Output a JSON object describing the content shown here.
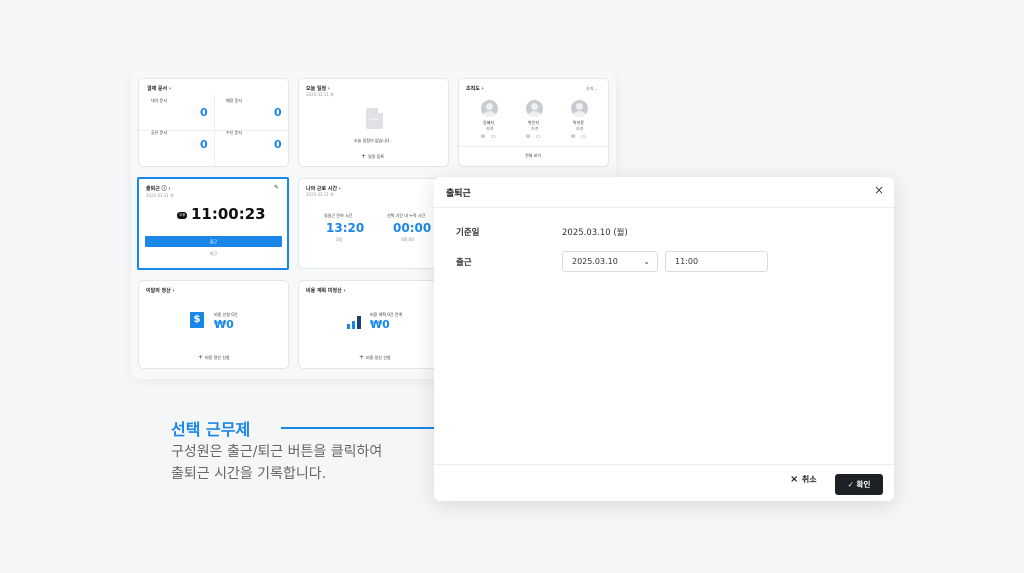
{
  "approval": {
    "title": "결재 문서",
    "items": [
      {
        "label": "대기 문서",
        "count": "0"
      },
      {
        "label": "예정 문서",
        "count": "0"
      },
      {
        "label": "공유 문서",
        "count": "0"
      },
      {
        "label": "수신 문서",
        "count": "0"
      }
    ]
  },
  "schedule": {
    "title": "오늘 일정",
    "date": "2025.03.11 화",
    "empty": "오늘 일정이 없습니다.",
    "add": "일정 등록"
  },
  "org": {
    "title": "조직도",
    "filter": "회계",
    "people": [
      {
        "name": "강혜지",
        "role": "회계"
      },
      {
        "name": "박은지",
        "role": "회계"
      },
      {
        "name": "박지윤",
        "role": "회계"
      }
    ],
    "view_all": "전체 보기"
  },
  "attendance": {
    "title": "출퇴근",
    "date": "2025.03.11 화",
    "badge": "오후",
    "time": "11:00:23",
    "in_label": "출근",
    "out_label": "퇴근"
  },
  "worktime": {
    "title": "나의 근로 시간",
    "date": "2025.03.11 화",
    "a_label": "일일근 잔여 시간",
    "a_value": "13:20",
    "a_sub": "3일",
    "b_label": "선택 기간 내 누적 시간",
    "b_value": "00:00",
    "b_sub": "/40:00"
  },
  "settle": {
    "title": "이달의 정산",
    "label": "비용 신청 0건",
    "amount": "₩0",
    "action": "비용 정산 신청"
  },
  "plan": {
    "title": "비용 계획 미정산",
    "label": "비용 계획 0건 잔액",
    "amount": "₩0",
    "action": "비용 정산 신청"
  },
  "modal": {
    "title": "출퇴근",
    "date_label": "기준일",
    "date_value": "2025.03.10 (월)",
    "in_label": "출근",
    "date_select": "2025.03.10",
    "time_value": "11:00",
    "cancel": "취소",
    "confirm": "확인"
  },
  "caption": {
    "title": "선택 근무제",
    "line1": "구성원은 출근/퇴근 버튼을 클릭하여",
    "line2": "출퇴근 시간을 기록합니다."
  },
  "colors": {
    "accent": "#1a86e8",
    "dark_button": "#1d2126"
  }
}
